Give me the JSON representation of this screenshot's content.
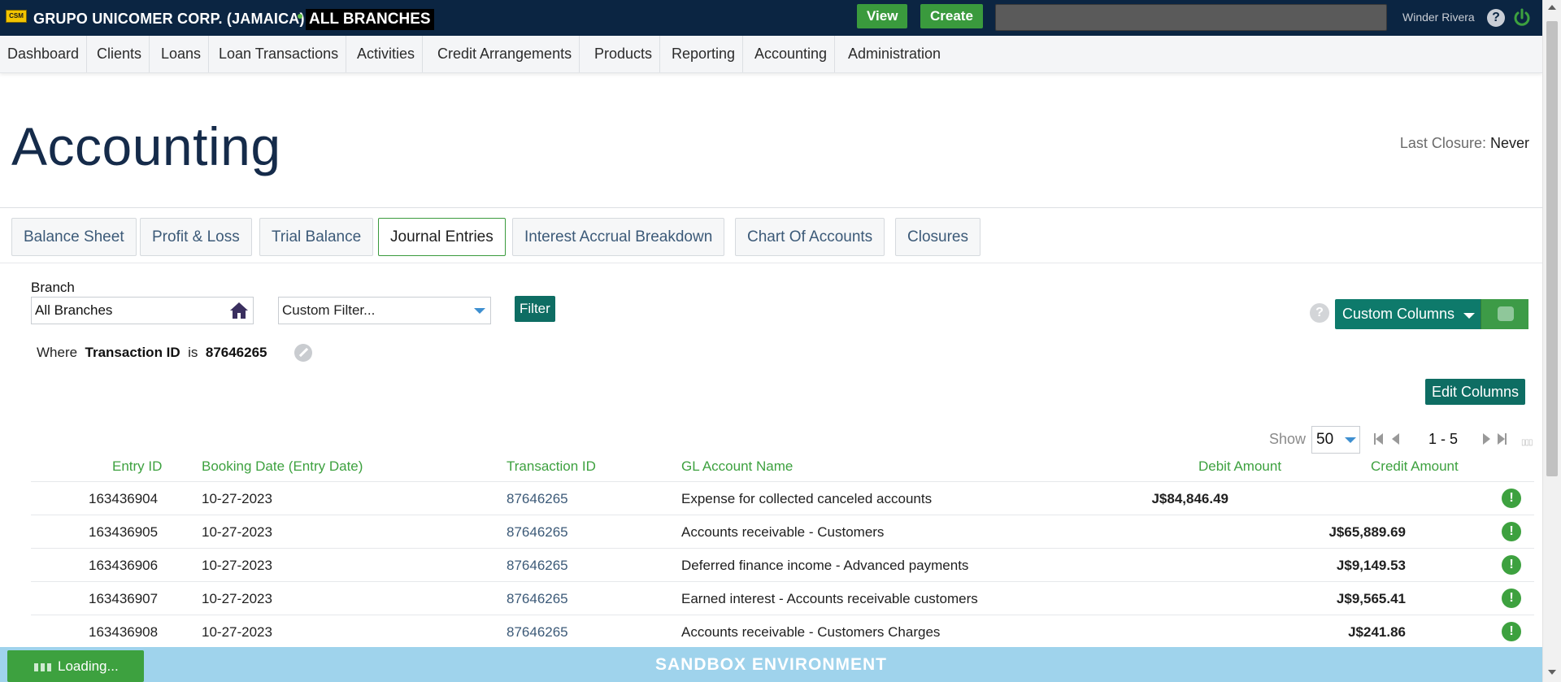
{
  "header": {
    "logo_text": "CSM",
    "org": "GRUPO UNICOMER CORP. (JAMAICA)",
    "branch_scope": "ALL BRANCHES",
    "view_label": "View",
    "create_label": "Create",
    "search_value": "",
    "user": "Winder Rivera",
    "help_icon": "help-icon",
    "power_icon": "power-icon"
  },
  "nav": [
    "Dashboard",
    "Clients",
    "Loans",
    "Loan  Transactions",
    "Activities",
    "Credit  Arrangements",
    "Products",
    "Reporting",
    "Accounting",
    "Administration"
  ],
  "page": {
    "title": "Accounting",
    "last_closure_label": "Last Closure:",
    "last_closure_value": "Never"
  },
  "tabs": [
    {
      "label": "Balance Sheet",
      "active": false
    },
    {
      "label": "Profit & Loss",
      "active": false
    },
    {
      "label": "Trial Balance",
      "active": false
    },
    {
      "label": "Journal Entries",
      "active": true
    },
    {
      "label": "Interest Accrual Breakdown",
      "active": false
    },
    {
      "label": "Chart Of Accounts",
      "active": false
    },
    {
      "label": "Closures",
      "active": false
    }
  ],
  "filters": {
    "branch_label": "Branch",
    "branch_value": "All Branches",
    "custom_filter_value": "Custom Filter...",
    "filter_button": "Filter",
    "where_word": "Where",
    "where_field": "Transaction ID",
    "where_op": "is",
    "where_value": "87646265"
  },
  "toolbar": {
    "custom_columns": "Custom  Columns",
    "edit_columns": "Edit  Columns"
  },
  "pager": {
    "show_label": "Show",
    "page_size": "50",
    "range": "1 - 5"
  },
  "table": {
    "headers": [
      "Entry ID",
      "Booking Date (Entry Date)",
      "Transaction ID",
      "GL Account Name",
      "Debit Amount",
      "Credit Amount"
    ],
    "rows": [
      {
        "entry_id": "163436904",
        "date": "10-27-2023",
        "txn": "87646265",
        "gl": "Expense for collected canceled accounts",
        "debit": "J$84,846.49",
        "credit": ""
      },
      {
        "entry_id": "163436905",
        "date": "10-27-2023",
        "txn": "87646265",
        "gl": "Accounts receivable - Customers",
        "debit": "",
        "credit": "J$65,889.69"
      },
      {
        "entry_id": "163436906",
        "date": "10-27-2023",
        "txn": "87646265",
        "gl": "Deferred finance income - Advanced payments",
        "debit": "",
        "credit": "J$9,149.53"
      },
      {
        "entry_id": "163436907",
        "date": "10-27-2023",
        "txn": "87646265",
        "gl": "Earned interest  - Accounts receivable customers",
        "debit": "",
        "credit": "J$9,565.41"
      },
      {
        "entry_id": "163436908",
        "date": "10-27-2023",
        "txn": "87646265",
        "gl": "Accounts receivable - Customers Charges",
        "debit": "",
        "credit": "J$241.86"
      }
    ]
  },
  "footer": {
    "loading": "Loading...",
    "sandbox": "SANDBOX ENVIRONMENT"
  },
  "colors": {
    "topbar": "#0b2542",
    "accent_green": "#3a9a3d",
    "teal": "#0e6d63",
    "sandbox": "#9fd3ec"
  }
}
